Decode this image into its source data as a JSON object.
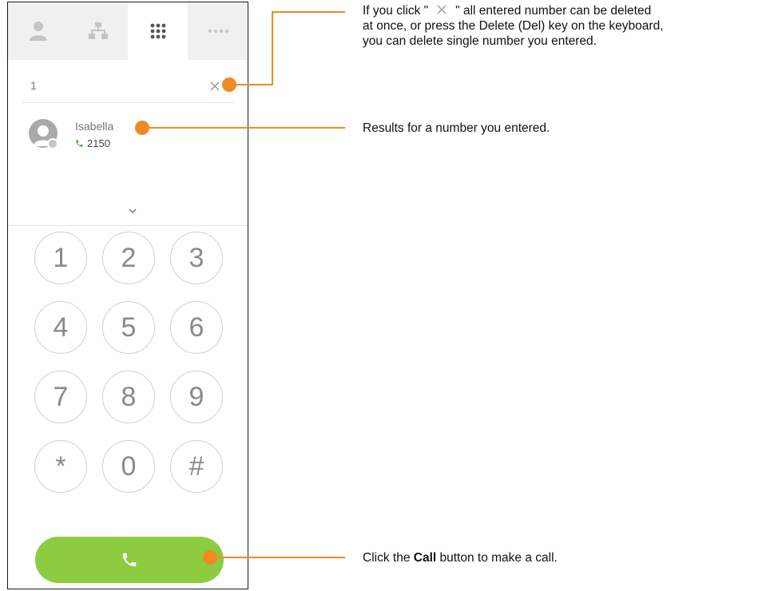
{
  "tabs": [
    {
      "name": "contacts",
      "icon": "person-icon"
    },
    {
      "name": "org-chart",
      "icon": "org-chart-icon"
    },
    {
      "name": "dialpad",
      "icon": "dialpad-icon",
      "active": true
    },
    {
      "name": "more",
      "icon": "more-icon"
    }
  ],
  "dial_input": {
    "value": "1",
    "clear_icon": "close-icon"
  },
  "result": {
    "name": "Isabella",
    "number": "2150",
    "phone_color": "#3aa845"
  },
  "keys": [
    "1",
    "2",
    "3",
    "4",
    "5",
    "6",
    "7",
    "8",
    "9",
    "*",
    "0",
    "#"
  ],
  "call_button": {
    "icon": "phone-icon",
    "color": "#8dcb41"
  },
  "annotations": {
    "clear_pre": "If you click \"",
    "clear_post": "\" all entered number can be deleted",
    "clear_line2": "at once, or press the Delete (Del) key on the keyboard,",
    "clear_line3": "you can delete single number you entered.",
    "results": "Results for a number you entered.",
    "call_pre": "Click the ",
    "call_bold": "Call",
    "call_post": " button to make a call."
  },
  "accent_color": "#f08a24"
}
